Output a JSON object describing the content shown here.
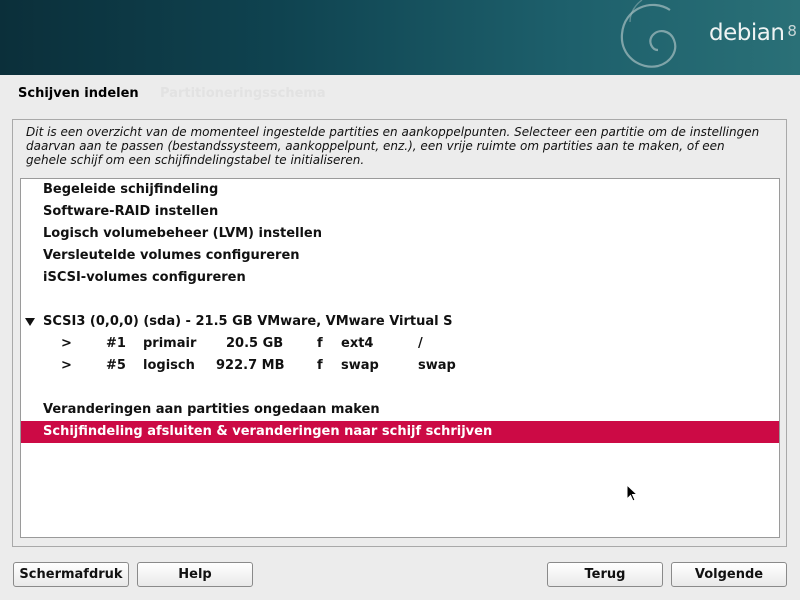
{
  "banner": {
    "brand": "debian",
    "version": "8",
    "colors": {
      "dark": "#0b2f3a",
      "light": "#2a7077"
    }
  },
  "page": {
    "title": "Schijven indelen",
    "title_ghost": "Partitioneringsschema",
    "description": "Dit is een overzicht van de momenteel ingestelde partities en aankoppelpunten. Selecteer een partitie om de instellingen daarvan aan te passen (bestandssysteem, aankoppelpunt, enz.), een vrije ruimte om partities aan te maken, of een gehele schijf om een schijfindelingstabel te initialiseren."
  },
  "menu": {
    "guided": "Begeleide schijfindeling",
    "raid": "Software-RAID instellen",
    "lvm": "Logisch volumebeheer (LVM) instellen",
    "crypto": "Versleutelde volumes configureren",
    "iscsi": "iSCSI-volumes configureren",
    "disk": "SCSI3 (0,0,0) (sda) - 21.5 GB VMware, VMware Virtual S",
    "partitions": [
      {
        "arrow": ">",
        "num": "#1",
        "type": "primair",
        "size": "20.5 GB",
        "flag": "f",
        "fs": "ext4",
        "mount": "/"
      },
      {
        "arrow": ">",
        "num": "#5",
        "type": "logisch",
        "size": "922.7 MB",
        "flag": "f",
        "fs": "swap",
        "mount": "swap"
      }
    ],
    "undo": "Veranderingen aan partities ongedaan maken",
    "finish": "Schijfindeling afsluiten & veranderingen naar schijf schrijven"
  },
  "selection_color": "#cc0a45",
  "buttons": {
    "screenshot": "Schermafdruk",
    "help": "Help",
    "back": "Terug",
    "next": "Volgende"
  }
}
